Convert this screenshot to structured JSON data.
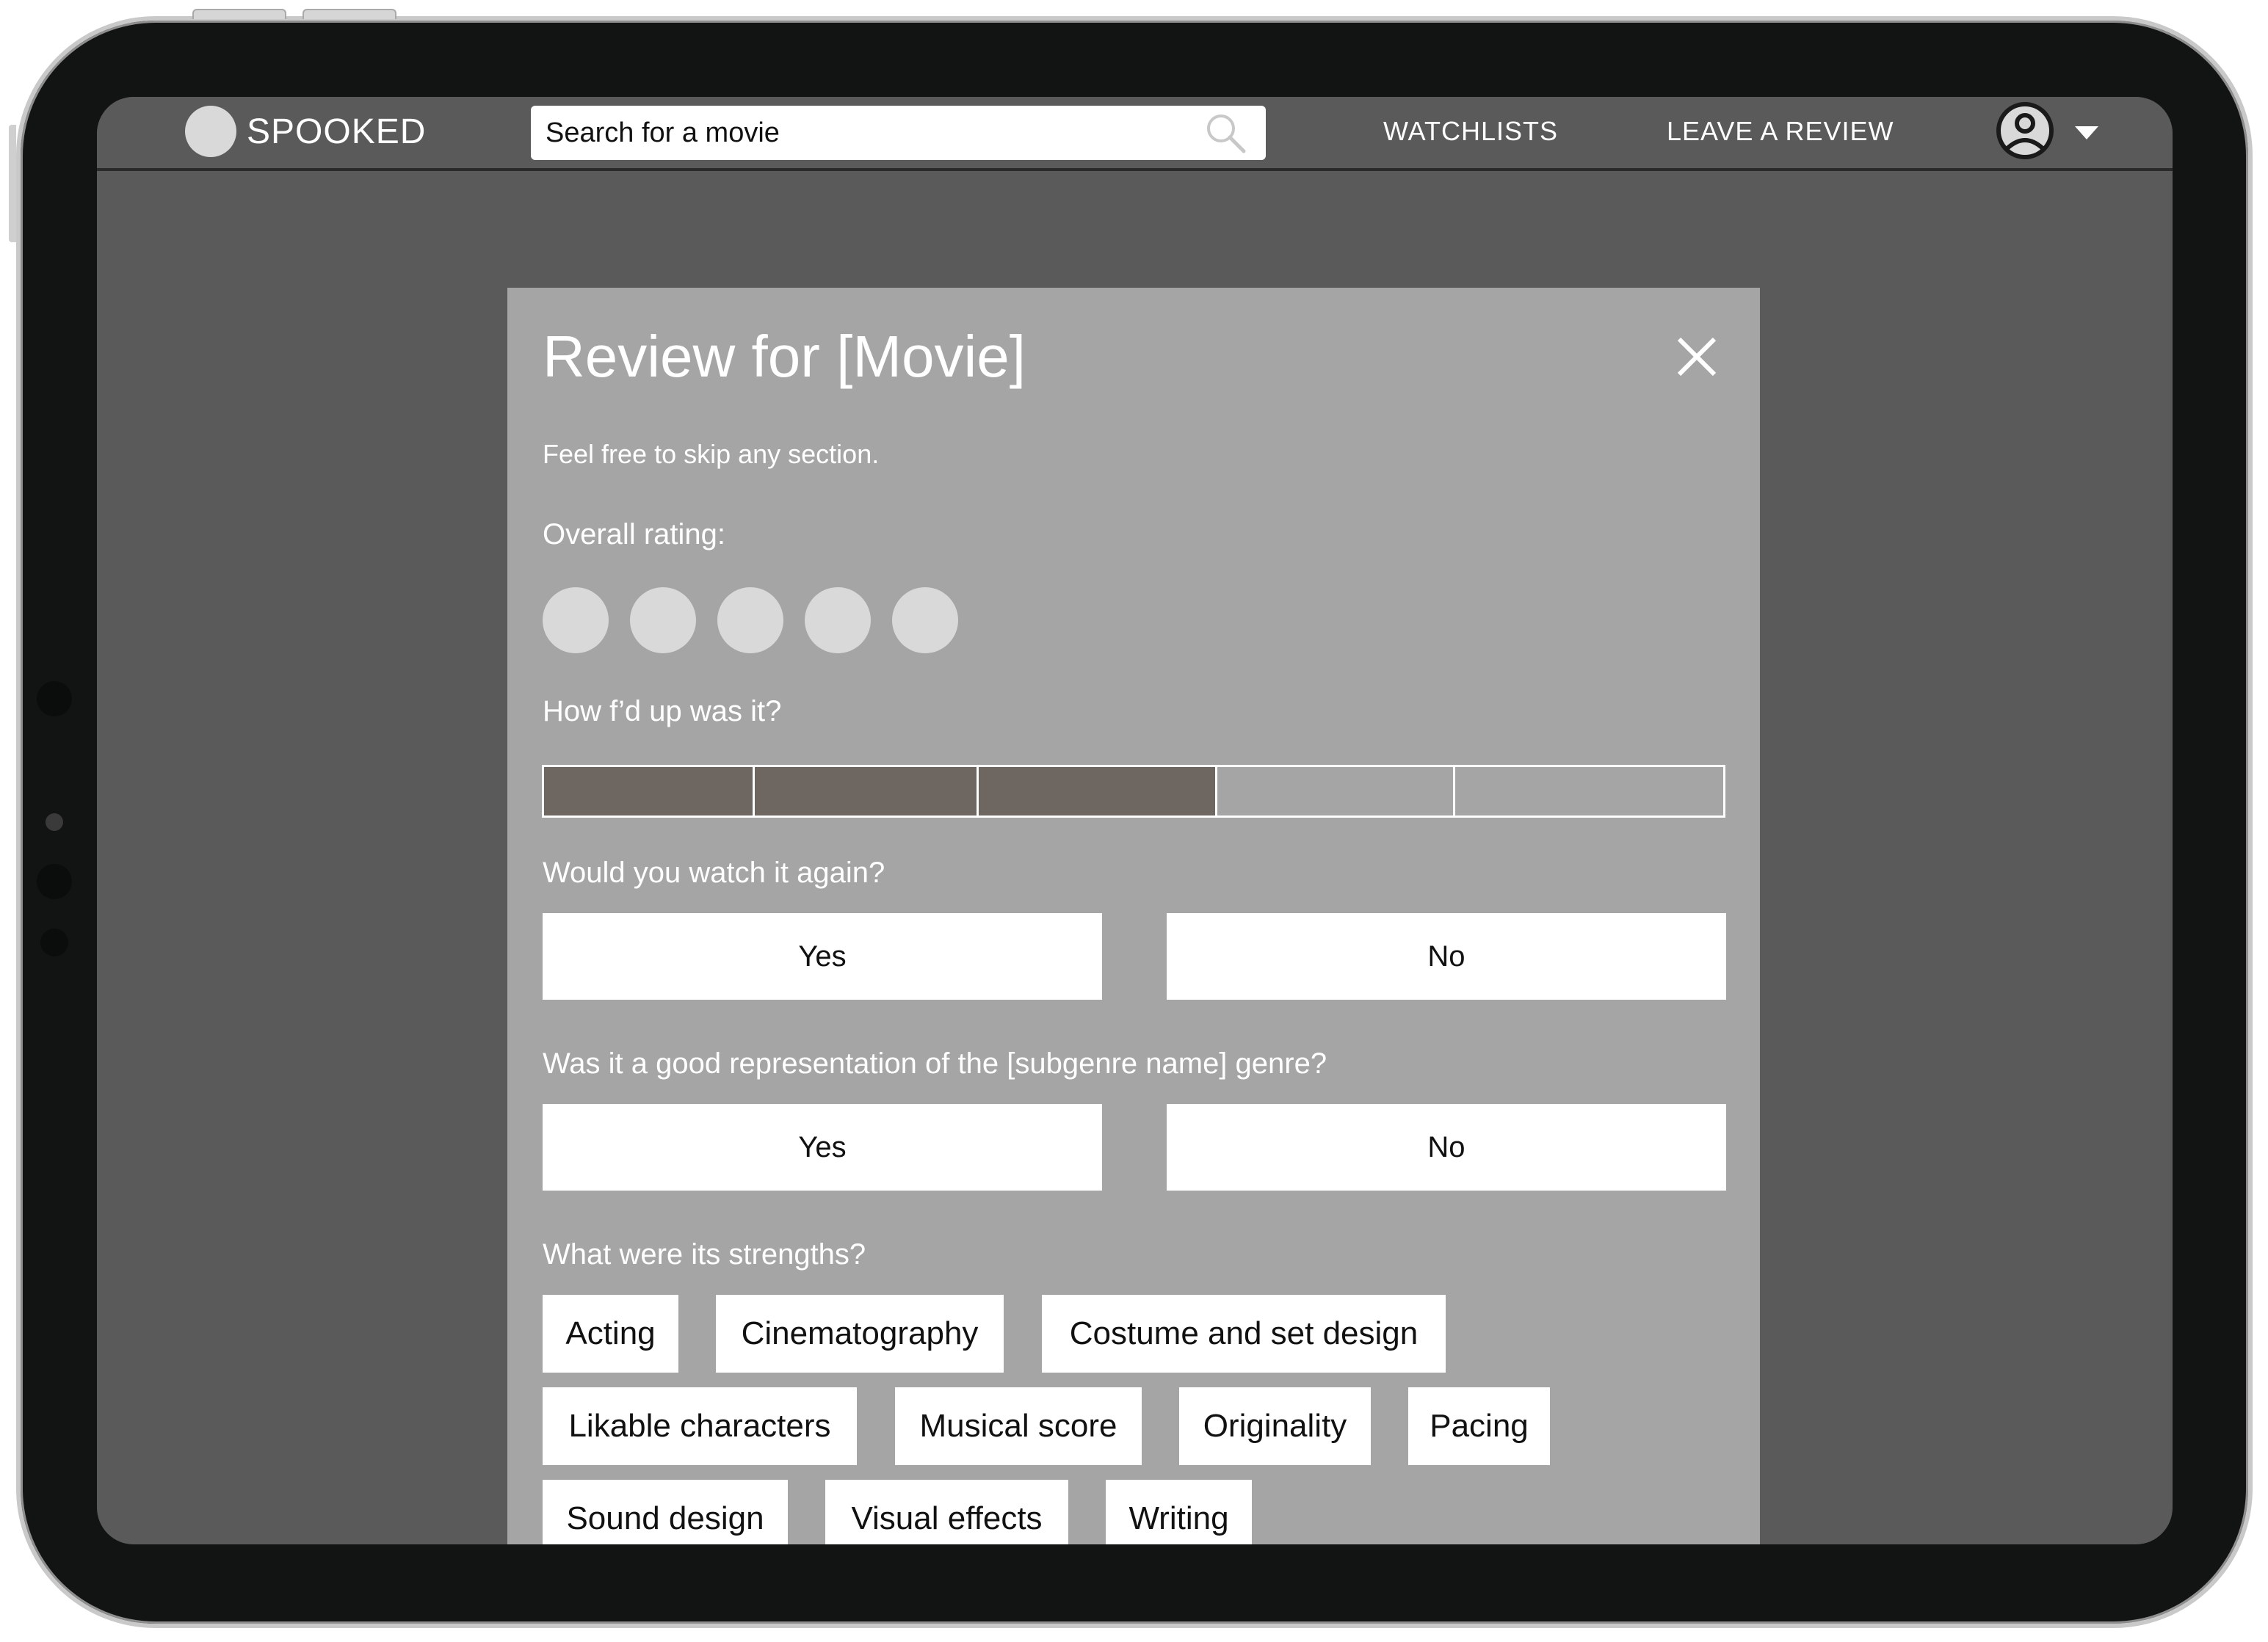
{
  "navbar": {
    "logo_text": "SPOOKED",
    "search": {
      "placeholder": "Search for a movie",
      "value": ""
    },
    "links": [
      {
        "label": "WATCHLISTS"
      },
      {
        "label": "LEAVE A REVIEW"
      }
    ],
    "account_icon": "user-circle-icon",
    "dropdown_icon": "caret-down-icon"
  },
  "modal": {
    "title": "Review for [Movie]",
    "close_icon": "close-icon",
    "subtitle": "Feel free to skip any section.",
    "overall_rating": {
      "label": "Overall rating:",
      "max": 5,
      "value": 0
    },
    "intensity": {
      "label": "How f’d up was it?",
      "segments": 5,
      "value": 3
    },
    "watch_again": {
      "label": "Would you watch it again?",
      "options": [
        "Yes",
        "No"
      ]
    },
    "genre_representation": {
      "label": "Was it a good representation of the [subgenre name] genre?",
      "options": [
        "Yes",
        "No"
      ]
    },
    "strengths": {
      "label": "What were its strengths?",
      "options": [
        "Acting",
        "Cinematography",
        "Costume and set design",
        "Likable characters",
        "Musical score",
        "Originality",
        "Pacing",
        "Sound design",
        "Visual effects",
        "Writing"
      ]
    }
  },
  "colors": {
    "screen_bg": "#5a5a5a",
    "modal_bg": "#a5a5a5",
    "rating_dot": "#d9d9d9",
    "scale_filled": "#6e6661"
  }
}
